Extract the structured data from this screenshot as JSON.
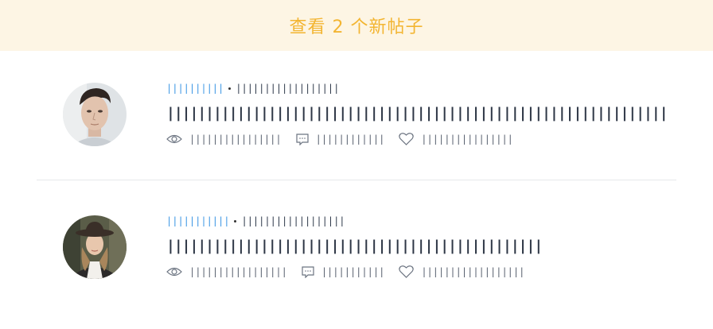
{
  "banner": {
    "text": "查看 2 个新帖子"
  },
  "posts": [
    {
      "author": "||||||||||",
      "time": "||||||||||||||||||",
      "title": "||||||||||||||||||||||||||||||||||||||||||||||||||||||||||||||||",
      "views_icon": "eye-icon",
      "views": "||||||||||||||||",
      "comments_icon": "comment-icon",
      "comments": "||||||||||||",
      "likes_icon": "heart-icon",
      "likes": "||||||||||||||||"
    },
    {
      "author": "|||||||||||",
      "time": "||||||||||||||||||",
      "title": "||||||||||||||||||||||||||||||||||||||||||||||||",
      "views_icon": "eye-icon",
      "views": "|||||||||||||||||",
      "comments_icon": "comment-icon",
      "comments": "|||||||||||",
      "likes_icon": "heart-icon",
      "likes": "||||||||||||||||||"
    }
  ],
  "colors": {
    "banner_bg": "#fdf5e4",
    "banner_text": "#f3b532",
    "author_link": "#3a95e4",
    "title": "#2d3645",
    "divider": "#e6e8eb"
  }
}
